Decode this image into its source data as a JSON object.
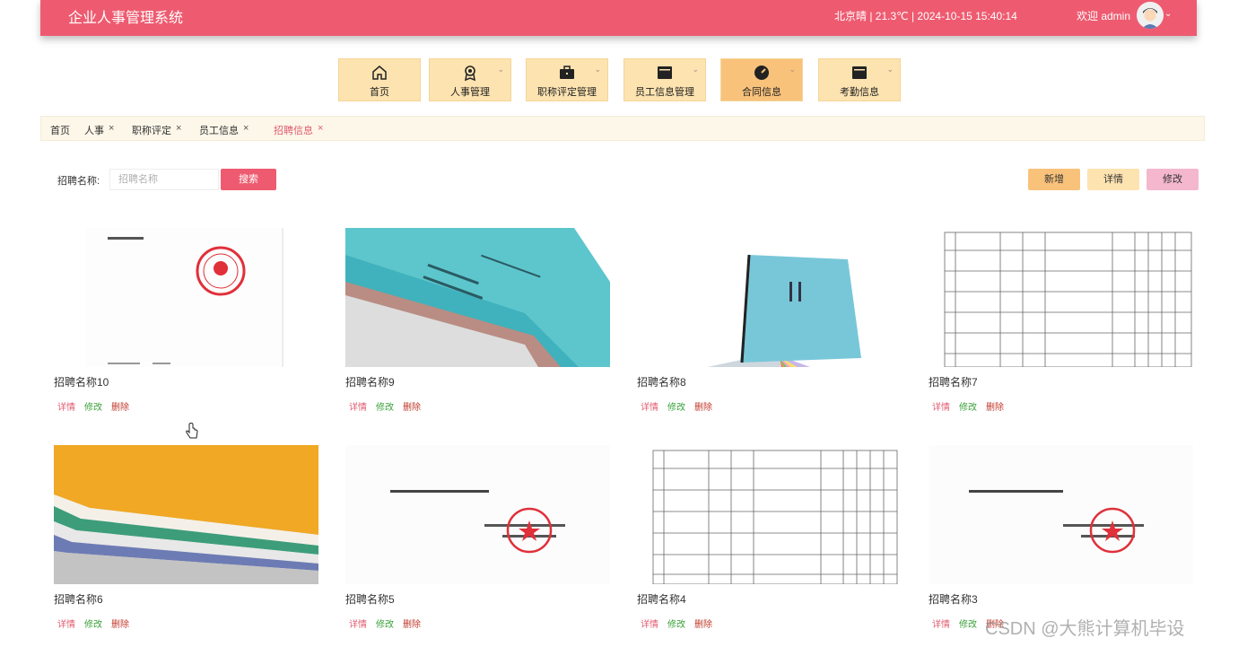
{
  "header": {
    "title": "企业人事管理系统",
    "weather": "北京晴 | 21.3℃  |  2024-10-15  15:40:14",
    "welcome": "欢迎 admin"
  },
  "nav": [
    {
      "label": "首页",
      "icon": "home-icon"
    },
    {
      "label": "人事管理",
      "icon": "badge-icon"
    },
    {
      "label": "职称评定管理",
      "icon": "briefcase-icon"
    },
    {
      "label": "员工信息管理",
      "icon": "folder-icon"
    },
    {
      "label": "合同信息",
      "icon": "gauge-icon"
    },
    {
      "label": "考勤信息",
      "icon": "folder-icon"
    }
  ],
  "breadcrumbs": [
    "首页",
    "人事",
    "职称评定",
    "员工信息",
    "招聘信息"
  ],
  "search": {
    "label": "招聘名称:",
    "placeholder": "招聘名称",
    "button": "搜索"
  },
  "toolbar": {
    "add": "新增",
    "detail": "详情",
    "edit": "修改"
  },
  "actions": {
    "detail": "详情",
    "edit": "修改",
    "delete": "删除"
  },
  "cards": [
    {
      "name": "招聘名称10"
    },
    {
      "name": "招聘名称9"
    },
    {
      "name": "招聘名称8"
    },
    {
      "name": "招聘名称7"
    },
    {
      "name": "招聘名称6"
    },
    {
      "name": "招聘名称5"
    },
    {
      "name": "招聘名称4"
    },
    {
      "name": "招聘名称3"
    }
  ],
  "watermark": "CSDN @大熊计算机毕设",
  "colors": {
    "primary": "#ee5b70",
    "nav": "#fde3b0",
    "nav_active": "#f9c27b",
    "edit_btn": "#f4b7cd"
  }
}
